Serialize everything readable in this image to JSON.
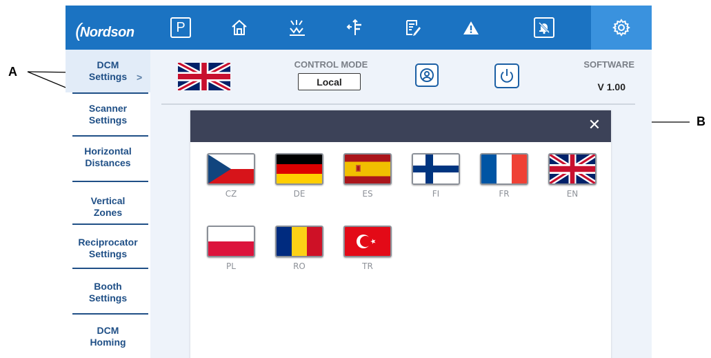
{
  "callouts": {
    "a": "A",
    "b": "B"
  },
  "brand": {
    "name": "Nordson",
    "swoosh": "("
  },
  "toolbar": {
    "items": [
      {
        "name": "parking-icon",
        "glyph": "P"
      },
      {
        "name": "home-icon"
      },
      {
        "name": "gun-trigger-icon"
      },
      {
        "name": "axis-icon"
      },
      {
        "name": "edit-list-icon"
      },
      {
        "name": "warning-icon"
      },
      {
        "name": "bell-mute-icon"
      },
      {
        "name": "gear-icon"
      }
    ],
    "colors": {
      "bar": "#1b73c2",
      "active": "#3a92de"
    }
  },
  "sidebar": {
    "items": [
      {
        "line1": "DCM",
        "line2": "Settings",
        "active": true
      },
      {
        "line1": "Scanner",
        "line2": "Settings"
      },
      {
        "line1": "Horizontal",
        "line2": "Distances"
      },
      {
        "line1": "Vertical",
        "line2": "Zones"
      },
      {
        "line1": "Reciprocator",
        "line2": "Settings"
      },
      {
        "line1": "Booth",
        "line2": "Settings"
      },
      {
        "line1": "DCM",
        "line2": "Homing"
      }
    ],
    "active_arrow": ">"
  },
  "header": {
    "current_language_flag": "EN",
    "control_mode_label": "CONTROL MODE",
    "control_mode_value": "Local",
    "software_label": "SOFTWARE",
    "software_version": "V 1.00"
  },
  "language_dialog": {
    "close_glyph": "✕",
    "languages": [
      {
        "code": "CZ"
      },
      {
        "code": "DE"
      },
      {
        "code": "ES"
      },
      {
        "code": "FI"
      },
      {
        "code": "FR"
      },
      {
        "code": "EN"
      },
      {
        "code": "PL"
      },
      {
        "code": "RO"
      },
      {
        "code": "TR"
      }
    ]
  }
}
